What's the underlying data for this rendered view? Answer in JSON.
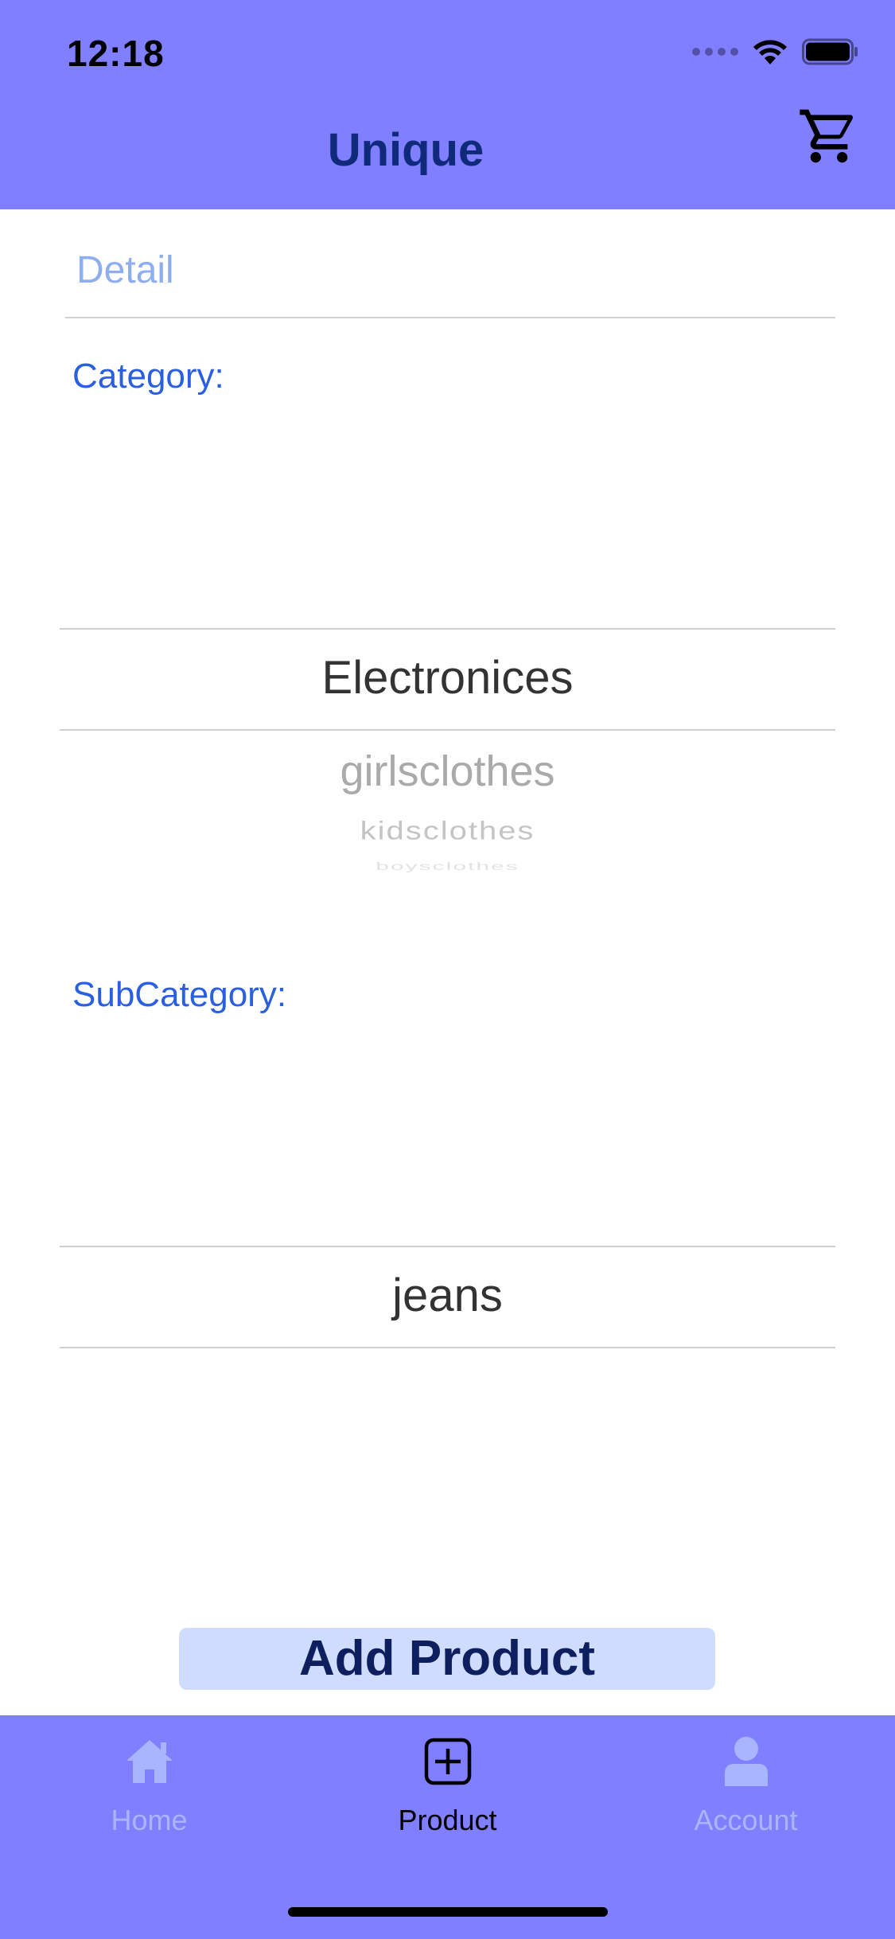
{
  "status_bar": {
    "time": "12:18"
  },
  "header": {
    "title": "Unique",
    "cart_icon": "cart-icon"
  },
  "form": {
    "detail": {
      "placeholder": "Detail",
      "value": ""
    },
    "category": {
      "label": "Category:",
      "selected": "Electronices",
      "options_below": [
        "girlsclothes",
        "kidsclothes",
        "boysclothes"
      ]
    },
    "subcategory": {
      "label": "SubCategory:",
      "selected": "jeans"
    },
    "submit_label": "Add Product"
  },
  "tabbar": {
    "tabs": [
      {
        "label": "Home",
        "icon": "home-icon",
        "active": false
      },
      {
        "label": "Product",
        "icon": "plus-square-icon",
        "active": true
      },
      {
        "label": "Account",
        "icon": "user-icon",
        "active": false
      }
    ]
  },
  "colors": {
    "header_bg": "#7f7fff",
    "title": "#102a7a",
    "label_blue": "#2a5fe0",
    "button_bg": "#cfdcfd",
    "button_text": "#0d1f5e",
    "tab_inactive": "#a9b6ff"
  }
}
